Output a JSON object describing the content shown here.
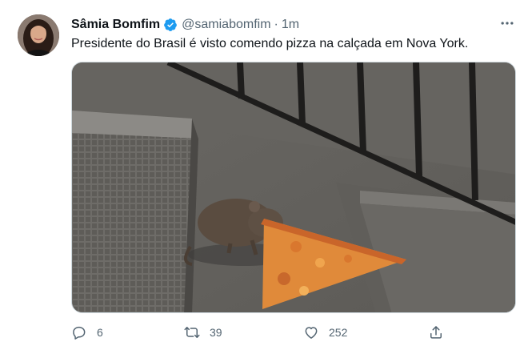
{
  "tweet": {
    "author_name": "Sâmia Bomfim",
    "handle": "@samiabomfim",
    "separator": "·",
    "time": "1m",
    "text": "Presidente do Brasil é visto comendo pizza na calçada em Nova York.",
    "verified": true
  },
  "actions": {
    "replies": "6",
    "retweets": "39",
    "likes": "252"
  },
  "icons": {
    "verified": "verified-badge-icon",
    "more": "more-horizontal-icon",
    "reply": "reply-icon",
    "retweet": "retweet-icon",
    "like": "heart-icon",
    "share": "share-icon"
  },
  "colors": {
    "verified_blue": "#1d9bf0",
    "secondary_text": "#536471",
    "primary_text": "#0f1419"
  }
}
